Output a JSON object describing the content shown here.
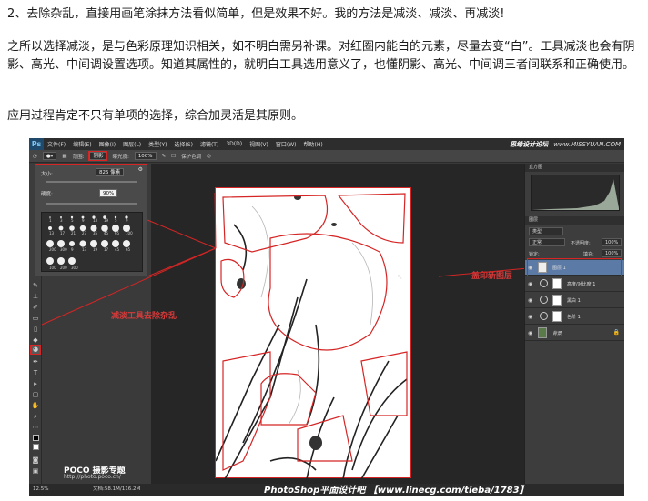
{
  "article": {
    "p1": "2、去除杂乱，直接用画笔涂抹方法看似简单，但是效果不好。我的方法是减淡、减淡、再减淡!",
    "p2": "之所以选择减淡，是与色彩原理知识相关，如不明白需另补课。对红圈内能白的元素，尽量去变“白”。工具减淡也会有阴影、高光、中间调设置选项。知道其属性的，就明白工具选用意义了，也懂阴影、高光、中间调三者间联系和正确使用。",
    "p3": "应用过程肯定不只有单项的选择，综合加灵活是其原则。"
  },
  "ps": {
    "logo": "Ps",
    "menu": [
      "文件(F)",
      "编辑(E)",
      "图像(I)",
      "图层(L)",
      "类型(Y)",
      "选择(S)",
      "滤镜(T)",
      "3D(D)",
      "视图(V)",
      "窗口(W)",
      "帮助(H)"
    ],
    "brand": "思缘设计论坛",
    "brand_site": "www.MISSYUAN.COM",
    "options": {
      "range_label": "范围:",
      "range_value": "阴影",
      "exposure_label": "曝光度:",
      "exposure_value": "100%",
      "protect_tones": "保护色调"
    },
    "brush_panel": {
      "size_label": "大小:",
      "size_value": "825 像素",
      "hardness_label": "硬度:",
      "hardness_value": "90%",
      "preset_labels": [
        "1",
        "3",
        "5",
        "9",
        "13",
        "19",
        "5",
        "9",
        "13",
        "17",
        "21",
        "27",
        "35",
        "45",
        "65",
        "100",
        "200",
        "300",
        "9",
        "13",
        "19",
        "17",
        "45",
        "65",
        "100",
        "200",
        "300"
      ]
    },
    "annotations": {
      "dodge_note": "减淡工具去除杂乱",
      "stamp_note": "盖印新图层"
    },
    "right": {
      "histogram_tab": "直方图",
      "layers_tab": "图层",
      "kind": "类型",
      "blend_mode": "正常",
      "opacity_label": "不透明度:",
      "opacity_value": "100%",
      "fill_label": "填充:",
      "fill_value": "100%",
      "lock_label": "锁定:",
      "layers": [
        {
          "name": "图层 1",
          "selected": true,
          "type": "pixel"
        },
        {
          "name": "高度/对比度 1",
          "selected": false,
          "type": "adjust"
        },
        {
          "name": "黑白 1",
          "selected": false,
          "type": "adjust"
        },
        {
          "name": "色阶 1",
          "selected": false,
          "type": "adjust"
        },
        {
          "name": "背景",
          "selected": false,
          "type": "background"
        }
      ]
    },
    "status": {
      "zoom": "12.5%",
      "doc_info": "文档:58.1M/116.2M"
    },
    "poco": "POCO 摄影专题",
    "poco_url": "http://photo.poco.cn/",
    "watermark": "PhotoShop平面设计吧 【www.linecg.com/tieba/1783】"
  }
}
